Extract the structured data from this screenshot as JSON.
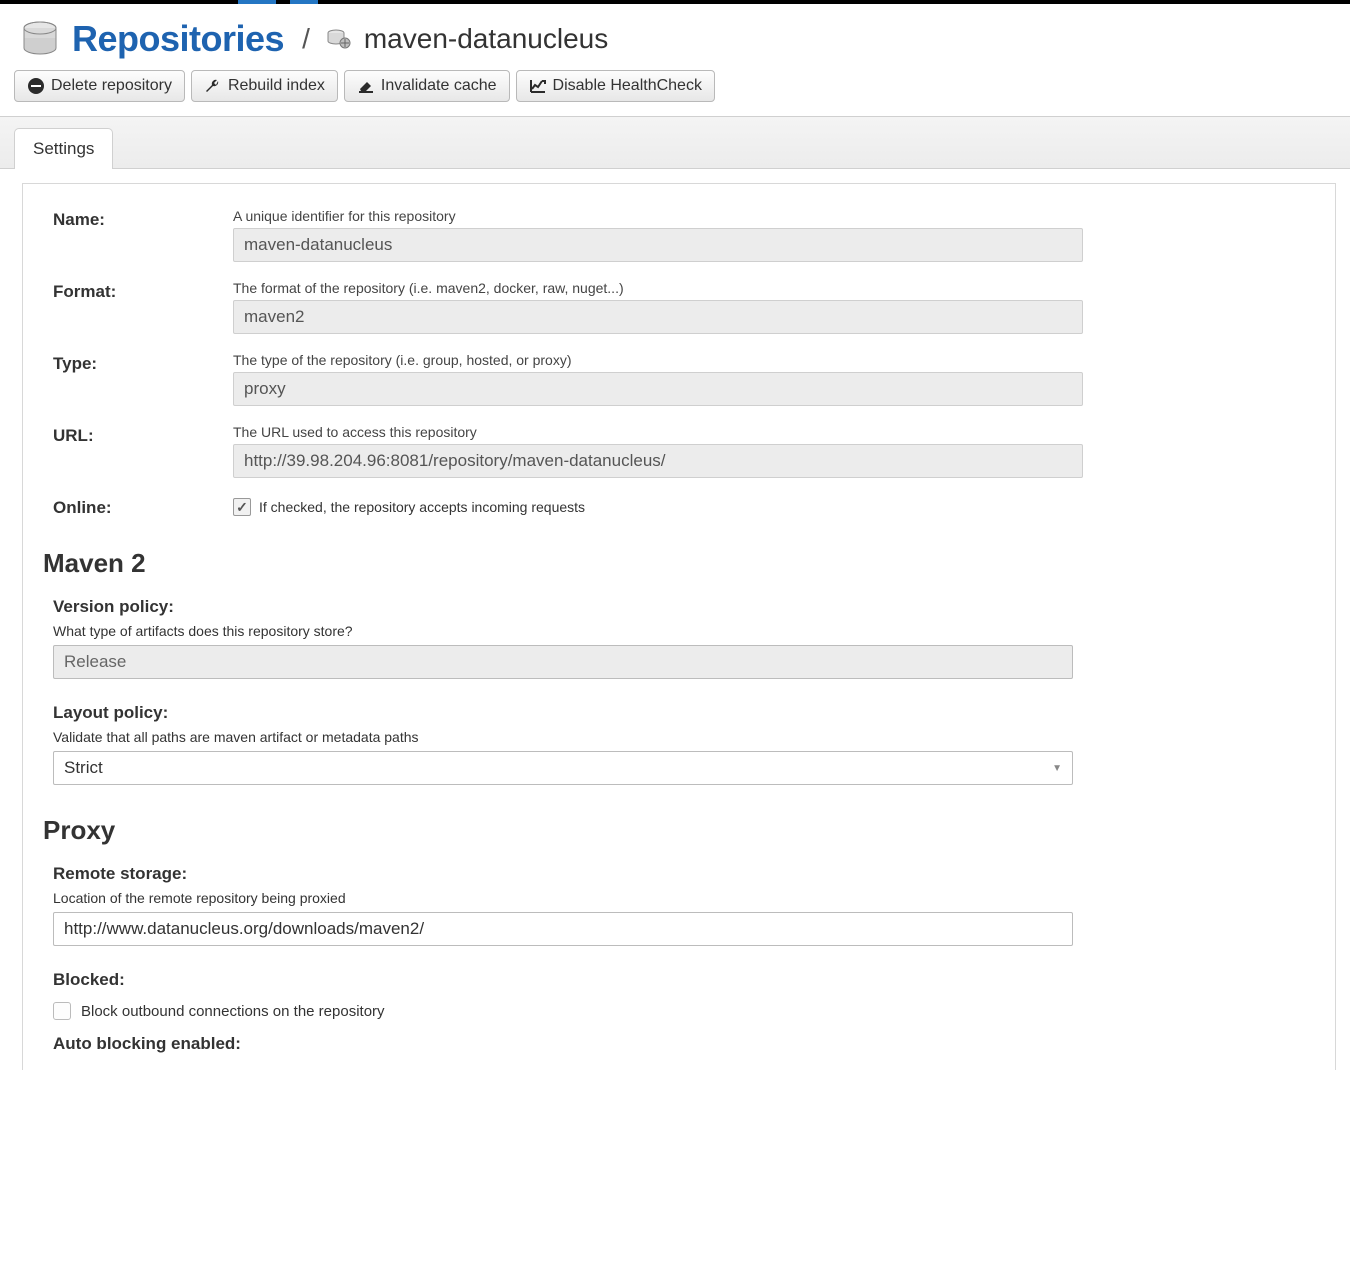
{
  "header": {
    "title": "Repositories",
    "breadcrumb_name": "maven-datanucleus"
  },
  "toolbar": {
    "delete": "Delete repository",
    "rebuild": "Rebuild index",
    "invalidate": "Invalidate cache",
    "disable_health": "Disable HealthCheck"
  },
  "tabs": {
    "settings": "Settings"
  },
  "form": {
    "name": {
      "label": "Name:",
      "help": "A unique identifier for this repository",
      "value": "maven-datanucleus"
    },
    "format": {
      "label": "Format:",
      "help": "The format of the repository (i.e. maven2, docker, raw, nuget...)",
      "value": "maven2"
    },
    "type": {
      "label": "Type:",
      "help": "The type of the repository (i.e. group, hosted, or proxy)",
      "value": "proxy"
    },
    "url": {
      "label": "URL:",
      "help": "The URL used to access this repository",
      "value": "http://39.98.204.96:8081/repository/maven-datanucleus/"
    },
    "online": {
      "label": "Online:",
      "help": "If checked, the repository accepts incoming requests"
    }
  },
  "maven2": {
    "heading": "Maven 2",
    "version_policy": {
      "label": "Version policy:",
      "help": "What type of artifacts does this repository store?",
      "value": "Release"
    },
    "layout_policy": {
      "label": "Layout policy:",
      "help": "Validate that all paths are maven artifact or metadata paths",
      "value": "Strict"
    }
  },
  "proxy": {
    "heading": "Proxy",
    "remote_storage": {
      "label": "Remote storage:",
      "help": "Location of the remote repository being proxied",
      "value": "http://www.datanucleus.org/downloads/maven2/"
    },
    "blocked": {
      "label": "Blocked:",
      "check_label": "Block outbound connections on the repository"
    },
    "auto_blocking": {
      "label": "Auto blocking enabled:"
    }
  }
}
